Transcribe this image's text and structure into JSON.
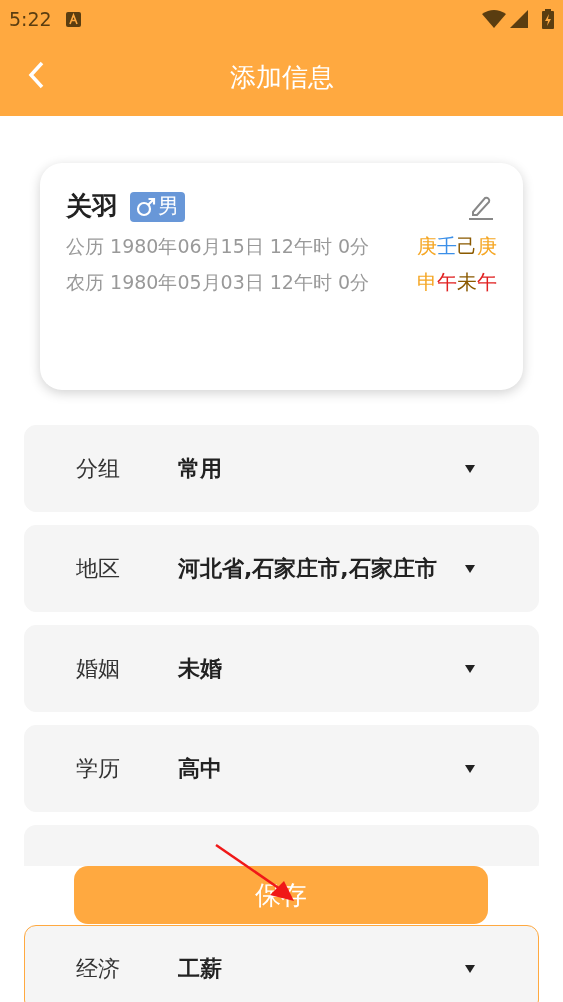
{
  "status_bar": {
    "time": "5:22"
  },
  "header": {
    "title": "添加信息"
  },
  "profile": {
    "name": "关羽",
    "gender": "男",
    "dates": [
      {
        "text": "公历 1980年06月15日 12午时 0分",
        "pillars": [
          {
            "text": "庚",
            "color": "#f5a623"
          },
          {
            "text": "壬",
            "color": "#3b8fe8"
          },
          {
            "text": "己",
            "color": "#8b5a00"
          },
          {
            "text": "庚",
            "color": "#f5a623"
          }
        ]
      },
      {
        "text": "农历 1980年05月03日 12午时 0分",
        "pillars": [
          {
            "text": "申",
            "color": "#f5a623"
          },
          {
            "text": "午",
            "color": "#e02020"
          },
          {
            "text": "未",
            "color": "#8b5a00"
          },
          {
            "text": "午",
            "color": "#e02020"
          }
        ]
      }
    ]
  },
  "fields": [
    {
      "label": "分组",
      "value": "常用",
      "selected": false
    },
    {
      "label": "地区",
      "value": "河北省,石家庄市,石家庄市",
      "selected": false
    },
    {
      "label": "婚姻",
      "value": "未婚",
      "selected": false
    },
    {
      "label": "学历",
      "value": "高中",
      "selected": false
    },
    {
      "kind": "covered",
      "selected": false
    },
    {
      "label": "经济",
      "value": "工薪",
      "selected": true
    }
  ],
  "save_button": {
    "label": "保存"
  }
}
